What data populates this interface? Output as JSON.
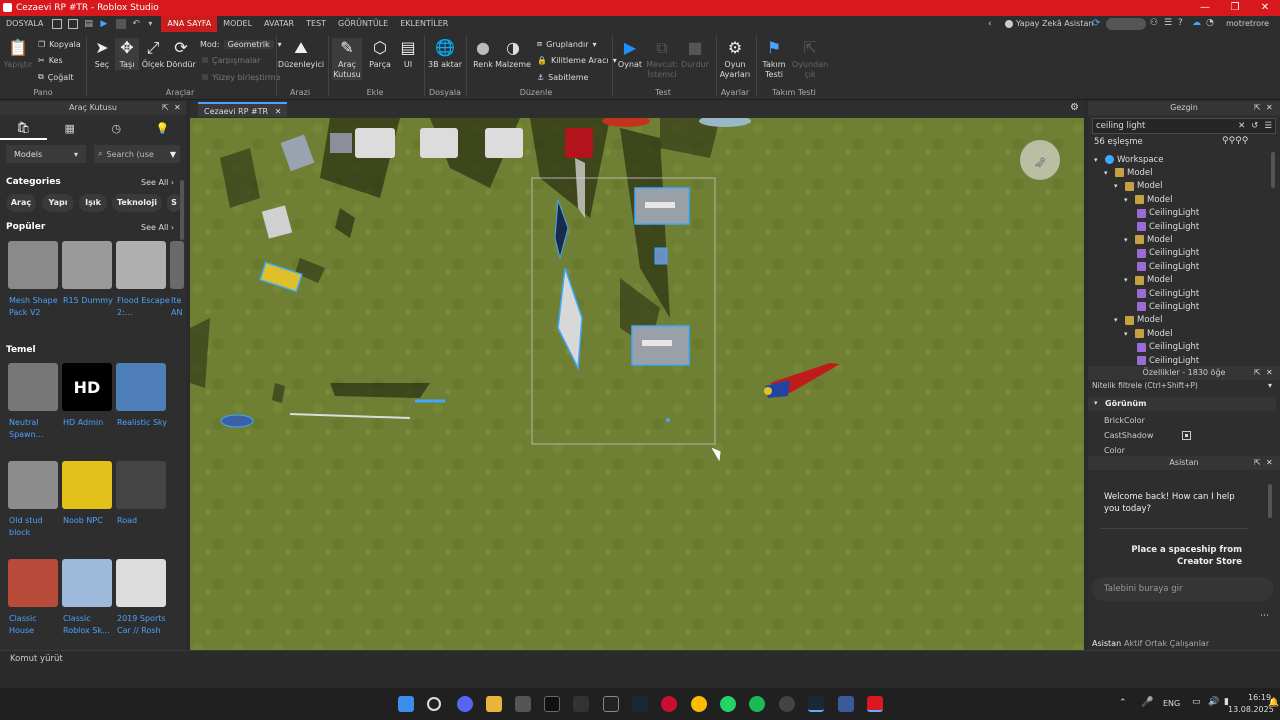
{
  "window": {
    "title": "Cezaevi RP #TR - Roblox Studio",
    "controls": [
      "—",
      "❐",
      "✕"
    ]
  },
  "menu": {
    "file": "DOSYALA",
    "tabs": [
      "ANA SAYFA",
      "MODEL",
      "AVATAR",
      "TEST",
      "GÖRÜNTÜLE",
      "EKLENTİLER"
    ],
    "assistant": "Yapay Zekâ Asistan",
    "user": "motretrore"
  },
  "ribbon": {
    "clipboard": {
      "paste": "Yapıştır",
      "copy": "Kopyala",
      "cut": "Kes",
      "duplicate": "Çoğalt",
      "group": "Pano"
    },
    "tools": {
      "select": "Seç",
      "move": "Taşı",
      "scale": "Ölçek",
      "rotate": "Döndür",
      "mode_label": "Mod:",
      "mode_value": "Geometrik",
      "collisions": "Çarpışmalar",
      "join": "Yüzey birleştirme",
      "group": "Araçlar"
    },
    "terrain": {
      "editor": "Düzenleyici",
      "group": "Arazi"
    },
    "insert": {
      "toolbox": "Araç Kutusu",
      "part": "Parça",
      "ui": "UI",
      "group": "Ekle"
    },
    "file": {
      "import3d": "3B aktar",
      "group": "Dosyala"
    },
    "edit": {
      "color": "Renk",
      "material": "Malzeme",
      "groupit": "Gruplandır",
      "lock": "Kilitleme Aracı",
      "anchor": "Sabitleme",
      "group": "Düzenle"
    },
    "test": {
      "play": "Oynat",
      "current": "Mevcut: İstemci",
      "stop": "Durdur",
      "group": "Test"
    },
    "settings": {
      "game": "Oyun Ayarları",
      "group": "Ayarlar"
    },
    "teamtest": {
      "team": "Takım Testi",
      "exit": "Oyundan çık",
      "group": "Takım Testi"
    }
  },
  "toolbox": {
    "title": "Araç Kutusu",
    "category_select": "Models",
    "search_placeholder": "Search (use",
    "categories_title": "Categories",
    "see_all": "See All",
    "chips": [
      "Araç",
      "Yapı",
      "Işık",
      "Teknoloji",
      "S"
    ],
    "popular_title": "Popüler",
    "popular": [
      {
        "label": "Mesh Shape Pack V2",
        "color": "#8a8a8a"
      },
      {
        "label": "R15 Dummy",
        "color": "#9a9a9a"
      },
      {
        "label": "Flood Escape 2:...",
        "color": "#b0b0b0"
      },
      {
        "label": "Ite AN",
        "color": "#6a6a6a"
      }
    ],
    "basic_title": "Temel",
    "basic": [
      {
        "label": "Neutral Spawn...",
        "color": "#777777"
      },
      {
        "label": "HD Admin",
        "color": "#000000",
        "text": "HD"
      },
      {
        "label": "Realistic Sky",
        "color": "#4f7fb8"
      },
      {
        "label": "Old stud block",
        "color": "#8c8c8c"
      },
      {
        "label": "Noob NPC",
        "color": "#e2c11a"
      },
      {
        "label": "Road",
        "color": "#444444"
      },
      {
        "label": "Classic House",
        "color": "#b84a3a"
      },
      {
        "label": "Classic Roblox Sk...",
        "color": "#9fb9db"
      },
      {
        "label": "2019 Sports Car // Rosh",
        "color": "#dddddd"
      }
    ]
  },
  "viewport": {
    "tab": "Cezaevi RP #TR",
    "top_gizmo": "Top"
  },
  "explorer": {
    "title": "Gezgin",
    "search_value": "ceiling light",
    "matches": "56 eşleşme",
    "items": [
      {
        "label": "Workspace",
        "indent": 0
      },
      {
        "label": "Model",
        "indent": 1
      },
      {
        "label": "Model",
        "indent": 2
      },
      {
        "label": "Model",
        "indent": 3
      },
      {
        "label": "CeilingLight",
        "indent": 4
      },
      {
        "label": "CeilingLight",
        "indent": 4
      },
      {
        "label": "Model",
        "indent": 3
      },
      {
        "label": "CeilingLight",
        "indent": 4
      },
      {
        "label": "CeilingLight",
        "indent": 4
      },
      {
        "label": "Model",
        "indent": 3
      },
      {
        "label": "CeilingLight",
        "indent": 4
      },
      {
        "label": "CeilingLight",
        "indent": 4
      },
      {
        "label": "Model",
        "indent": 2
      },
      {
        "label": "Model",
        "indent": 3
      },
      {
        "label": "CeilingLight",
        "indent": 4
      },
      {
        "label": "CeilingLight",
        "indent": 4
      }
    ]
  },
  "properties": {
    "title": "Özellikler - 1830 öğe",
    "filter": "Nitelik filtrele (Ctrl+Shift+P)",
    "section": "Görünüm",
    "rows": [
      "BrickColor",
      "CastShadow",
      "Color"
    ]
  },
  "assistant": {
    "title": "Asistan",
    "welcome": "Welcome back! How can I help you today?",
    "suggestion": "Place a spaceship from Creator Store",
    "input_placeholder": "Talebini buraya gir",
    "tabs": [
      "Asistan",
      "Aktif Ortak Çalışanlar"
    ]
  },
  "command_bar": {
    "placeholder": "Komut yürüt"
  },
  "taskbar": {
    "lang": "ENG",
    "time": "16:19",
    "date": "13.08.2025"
  }
}
